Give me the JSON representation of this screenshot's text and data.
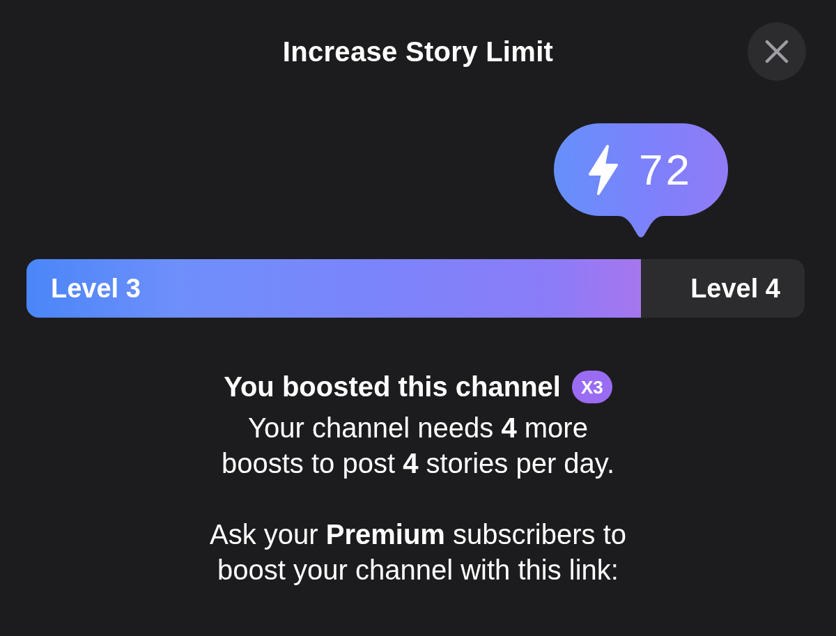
{
  "title": "Increase Story Limit",
  "boost_bubble": {
    "count": "72"
  },
  "progress": {
    "level": 0.79,
    "current_label": "Level 3",
    "next_label": "Level 4"
  },
  "status": {
    "heading": "You boosted this channel",
    "badge": "X3"
  },
  "paragraphs": [
    "Your channel needs **4** more boosts to post **4** stories per day.",
    "Ask your **Premium** subscribers to boost your channel with this link:"
  ]
}
